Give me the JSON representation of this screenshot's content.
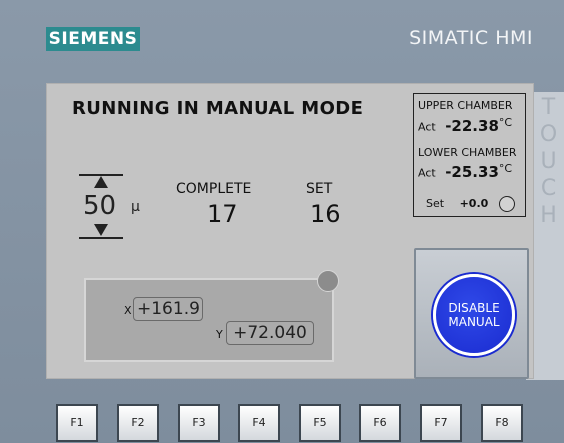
{
  "header": {
    "brand": "SIEMENS",
    "product": "SIMATIC HMI",
    "side_label": "TOUCH"
  },
  "screen": {
    "mode_title": "RUNNING IN MANUAL MODE",
    "thickness": {
      "value": "50",
      "unit": "μ"
    },
    "counters": {
      "complete_label": "COMPLETE",
      "complete_value": "17",
      "set_label": "SET",
      "set_value": "16"
    },
    "position": {
      "x_label": "X",
      "x_value": "+161.9",
      "y_label": "Y",
      "y_value": "+72.040"
    },
    "chambers": {
      "upper_label": "UPPER CHAMBER",
      "upper_act_label": "Act",
      "upper_act_value": "-22.38",
      "lower_label": "LOWER CHAMBER",
      "lower_act_label": "Act",
      "lower_act_value": "-25.33",
      "unit": "°C",
      "set_label": "Set",
      "set_value": "+0.0"
    },
    "disable_button": {
      "line1": "DISABLE",
      "line2": "MANUAL"
    }
  },
  "function_keys": [
    "F1",
    "F2",
    "F3",
    "F4",
    "F5",
    "F6",
    "F7",
    "F8"
  ],
  "colors": {
    "bezel": "#8796a6",
    "brand": "#2c8b8f",
    "screen": "#c4c4c4",
    "disable_button": "#1f35e0"
  }
}
